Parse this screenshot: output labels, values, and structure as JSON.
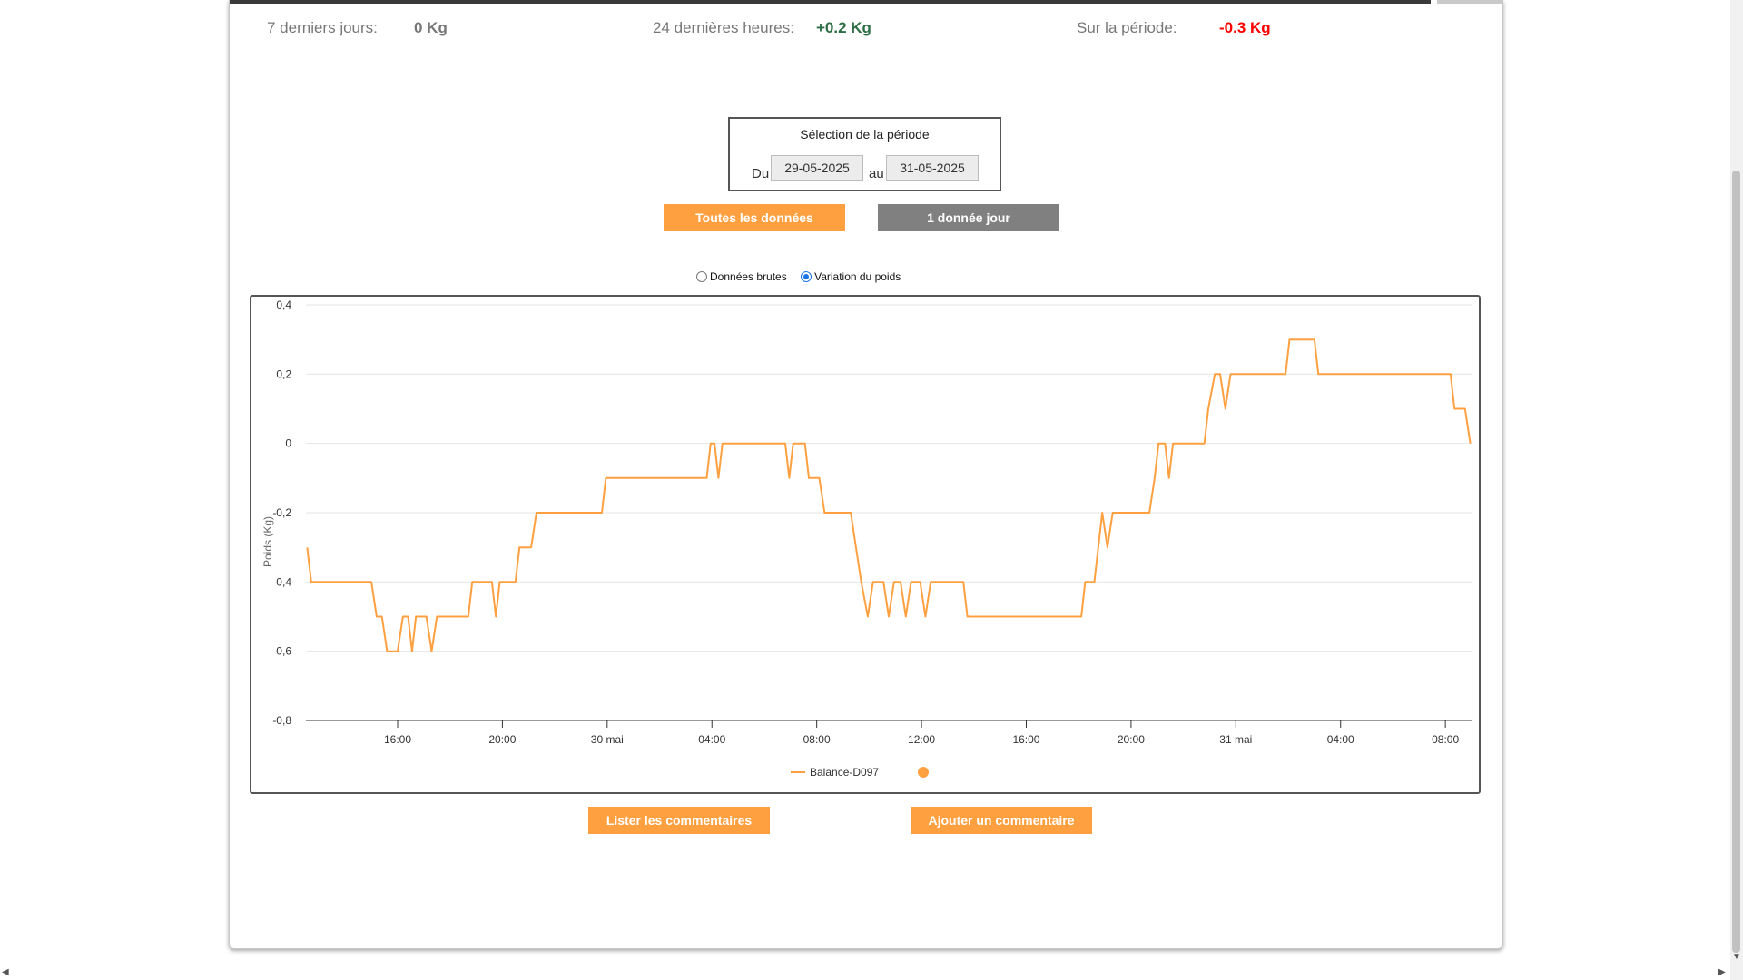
{
  "stats": {
    "last7_label": "7 derniers jours:",
    "last7_value": "0 Kg",
    "last24_label": "24 dernières heures:",
    "last24_value": "+0.2 Kg",
    "period_label": "Sur la période:",
    "period_value": "-0.3 Kg"
  },
  "period_selection": {
    "title": "Sélection de la période",
    "from_label": "Du",
    "from_value": "29-05-2025",
    "to_label": "au",
    "to_value": "31-05-2025"
  },
  "buttons": {
    "all_data": "Toutes les données",
    "one_per_day": "1 donnée jour",
    "list_comments": "Lister les commentaires",
    "add_comment": "Ajouter un commentaire"
  },
  "view_options": {
    "raw_label": "Données brutes",
    "variation_label": "Variation du poids",
    "selected": "variation"
  },
  "colors": {
    "accent": "#ffa040",
    "series": "#ffa040",
    "positive": "#2e6e46",
    "negative": "#ff0000",
    "neutral_button": "#808080"
  },
  "chart_data": {
    "type": "line",
    "title": "",
    "xlabel": "",
    "ylabel": "Poids (Kg)",
    "ylim": [
      -0.8,
      0.4
    ],
    "yticks": [
      {
        "v": 0.4,
        "label": "0,4"
      },
      {
        "v": 0.2,
        "label": "0,2"
      },
      {
        "v": 0,
        "label": "0"
      },
      {
        "v": -0.2,
        "label": "-0,2"
      },
      {
        "v": -0.4,
        "label": "-0,4"
      },
      {
        "v": -0.6,
        "label": "-0,6"
      },
      {
        "v": -0.8,
        "label": "-0,8"
      }
    ],
    "x_unit": "hours from 29 mai 00:00",
    "xlim": [
      12.5,
      57
    ],
    "xticks": [
      {
        "t": 16,
        "label": "16:00"
      },
      {
        "t": 20,
        "label": "20:00"
      },
      {
        "t": 24,
        "label": "30 mai"
      },
      {
        "t": 28,
        "label": "04:00"
      },
      {
        "t": 32,
        "label": "08:00"
      },
      {
        "t": 36,
        "label": "12:00"
      },
      {
        "t": 40,
        "label": "16:00"
      },
      {
        "t": 44,
        "label": "20:00"
      },
      {
        "t": 48,
        "label": "31 mai"
      },
      {
        "t": 52,
        "label": "04:00"
      },
      {
        "t": 56,
        "label": "08:00"
      }
    ],
    "grid": true,
    "legend": "bottom-center",
    "series": [
      {
        "name": "Balance-D097",
        "color": "#ffa040",
        "points": [
          [
            12.55,
            -0.3
          ],
          [
            12.7,
            -0.4
          ],
          [
            15.0,
            -0.4
          ],
          [
            15.2,
            -0.5
          ],
          [
            15.4,
            -0.5
          ],
          [
            15.6,
            -0.6
          ],
          [
            16.0,
            -0.6
          ],
          [
            16.2,
            -0.5
          ],
          [
            16.4,
            -0.5
          ],
          [
            16.55,
            -0.6
          ],
          [
            16.7,
            -0.5
          ],
          [
            17.1,
            -0.5
          ],
          [
            17.3,
            -0.6
          ],
          [
            17.5,
            -0.5
          ],
          [
            18.7,
            -0.5
          ],
          [
            18.85,
            -0.4
          ],
          [
            19.6,
            -0.4
          ],
          [
            19.75,
            -0.5
          ],
          [
            19.9,
            -0.4
          ],
          [
            20.5,
            -0.4
          ],
          [
            20.65,
            -0.3
          ],
          [
            21.1,
            -0.3
          ],
          [
            21.3,
            -0.2
          ],
          [
            23.8,
            -0.2
          ],
          [
            23.95,
            -0.1
          ],
          [
            27.8,
            -0.1
          ],
          [
            27.95,
            0
          ],
          [
            28.1,
            0
          ],
          [
            28.25,
            -0.1
          ],
          [
            28.4,
            0
          ],
          [
            30.8,
            0
          ],
          [
            30.95,
            -0.1
          ],
          [
            31.1,
            0
          ],
          [
            31.55,
            0
          ],
          [
            31.7,
            -0.1
          ],
          [
            32.1,
            -0.1
          ],
          [
            32.3,
            -0.2
          ],
          [
            33.3,
            -0.2
          ],
          [
            33.5,
            -0.3
          ],
          [
            33.7,
            -0.4
          ],
          [
            33.95,
            -0.5
          ],
          [
            34.15,
            -0.4
          ],
          [
            34.55,
            -0.4
          ],
          [
            34.75,
            -0.5
          ],
          [
            34.95,
            -0.4
          ],
          [
            35.2,
            -0.4
          ],
          [
            35.4,
            -0.5
          ],
          [
            35.6,
            -0.4
          ],
          [
            35.95,
            -0.4
          ],
          [
            36.15,
            -0.5
          ],
          [
            36.35,
            -0.4
          ],
          [
            37.6,
            -0.4
          ],
          [
            37.75,
            -0.5
          ],
          [
            42.1,
            -0.5
          ],
          [
            42.25,
            -0.4
          ],
          [
            42.6,
            -0.4
          ],
          [
            42.75,
            -0.3
          ],
          [
            42.9,
            -0.2
          ],
          [
            43.1,
            -0.3
          ],
          [
            43.3,
            -0.2
          ],
          [
            44.7,
            -0.2
          ],
          [
            44.9,
            -0.1
          ],
          [
            45.05,
            0
          ],
          [
            45.3,
            0
          ],
          [
            45.45,
            -0.1
          ],
          [
            45.6,
            0
          ],
          [
            46.8,
            0
          ],
          [
            46.95,
            0.1
          ],
          [
            47.2,
            0.2
          ],
          [
            47.4,
            0.2
          ],
          [
            47.6,
            0.1
          ],
          [
            47.8,
            0.2
          ],
          [
            49.9,
            0.2
          ],
          [
            50.05,
            0.3
          ],
          [
            51.0,
            0.3
          ],
          [
            51.15,
            0.2
          ],
          [
            56.2,
            0.2
          ],
          [
            56.35,
            0.1
          ],
          [
            56.75,
            0.1
          ],
          [
            56.95,
            0
          ]
        ]
      }
    ]
  }
}
